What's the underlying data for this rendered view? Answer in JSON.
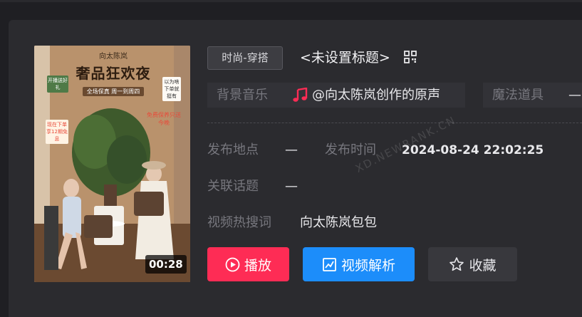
{
  "video": {
    "duration": "00:28",
    "thumbnail": {
      "top_text": "向太陈岚",
      "title": "奢品狂欢夜",
      "subtitle": "全场保真 周一到周四",
      "sticker_left": "开播送好礼",
      "note_left": "现在下单享12期免息",
      "note_right": "以为啥下单就挺有",
      "tag_right": "免费保养只送今晚"
    }
  },
  "category_tag": "时尚-穿搭",
  "title": "<未设置标题>",
  "bg_music": {
    "label": "背景音乐",
    "value": "@向太陈岚创作的原声",
    "icon": "music-note-icon",
    "icon_color": "#fe2c55"
  },
  "magic_props": {
    "label": "魔法道具",
    "value": "—"
  },
  "location": {
    "label": "发布地点",
    "value": "—"
  },
  "publish_time": {
    "label": "发布时间",
    "value": "2024-08-24 22:02:25"
  },
  "topics": {
    "label": "关联话题",
    "value": "—"
  },
  "hot_search": {
    "label": "视频热搜词",
    "value": "向太陈岚包包"
  },
  "buttons": {
    "play": "播放",
    "analyze": "视频解析",
    "favorite": "收藏"
  },
  "watermark": "XD.NEWRANK.CN",
  "colors": {
    "play": "#fe2c55",
    "analyze": "#1c8dfa",
    "favorite": "#38383d"
  }
}
